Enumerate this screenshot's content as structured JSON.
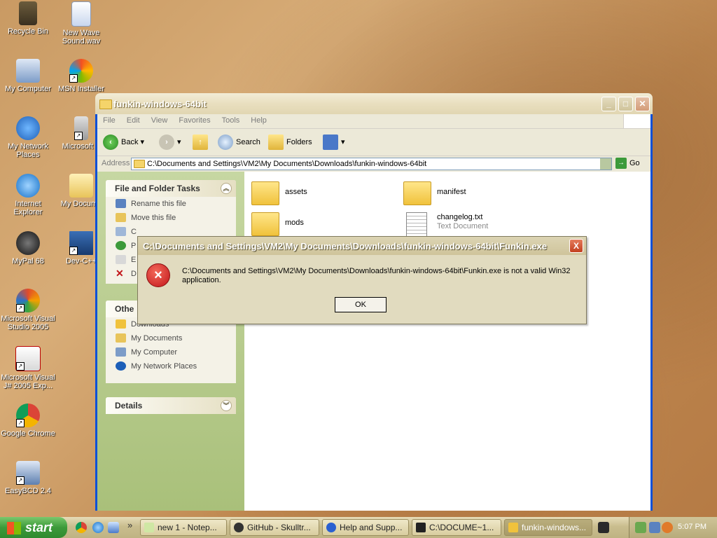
{
  "desktop_icons": [
    {
      "label": "Recycle Bin",
      "icon": "recycle-bin-icon"
    },
    {
      "label": "New Wave Sound.wav",
      "icon": "media-file-icon"
    },
    {
      "label": "My Computer",
      "icon": "my-computer-icon"
    },
    {
      "label": "MSN Installer",
      "icon": "msn-icon"
    },
    {
      "label": "My Network Places",
      "icon": "network-places-icon"
    },
    {
      "label": "Microsoft P",
      "icon": "shortcut-icon"
    },
    {
      "label": "Internet Explorer",
      "icon": "internet-explorer-icon"
    },
    {
      "label": "My Docume",
      "icon": "my-documents-icon"
    },
    {
      "label": "MyPal 68",
      "icon": "mypal-icon"
    },
    {
      "label": "Dev-C++",
      "icon": "devcpp-icon"
    },
    {
      "label": "Microsoft Visual Studio 2005",
      "icon": "visual-studio-icon"
    },
    {
      "label": "Microsoft Visual J# 2005 Exp...",
      "icon": "visual-j-icon"
    },
    {
      "label": "Google Chrome",
      "icon": "chrome-icon"
    },
    {
      "label": "EasyBCD 2.4",
      "icon": "easybcd-icon"
    }
  ],
  "explorer": {
    "title": "funkin-windows-64bit",
    "menu": [
      "File",
      "Edit",
      "View",
      "Favorites",
      "Tools",
      "Help"
    ],
    "toolbar": {
      "back": "Back",
      "search": "Search",
      "folders": "Folders"
    },
    "address_label": "Address",
    "address": "C:\\Documents and Settings\\VM2\\My Documents\\Downloads\\funkin-windows-64bit",
    "go": "Go",
    "tasks_panel": {
      "title": "File and Folder Tasks",
      "items": [
        "Rename this file",
        "Move this file",
        "C",
        "P",
        "E",
        "D"
      ]
    },
    "other_panel": {
      "title": "Othe",
      "items": [
        "Downloads",
        "My Documents",
        "My Computer",
        "My Network Places"
      ]
    },
    "details_panel": {
      "title": "Details"
    },
    "files": [
      {
        "name": "assets",
        "subtitle": ""
      },
      {
        "name": "manifest",
        "subtitle": ""
      },
      {
        "name": "mods",
        "subtitle": ""
      },
      {
        "name": "changelog.txt",
        "subtitle": "Text Document"
      }
    ]
  },
  "dialog": {
    "title": "C:\\Documents and Settings\\VM2\\My Documents\\Downloads\\funkin-windows-64bit\\Funkin.exe",
    "message": "C:\\Documents and Settings\\VM2\\My Documents\\Downloads\\funkin-windows-64bit\\Funkin.exe is not a valid Win32 application.",
    "ok": "OK",
    "close": "X",
    "error_glyph": "×"
  },
  "taskbar": {
    "start": "start",
    "tasks": [
      "new 1 - Notep...",
      "GitHub - Skulltr...",
      "Help and Supp...",
      "C:\\DOCUME~1...",
      "funkin-windows..."
    ],
    "clock": "5:07 PM",
    "overflow": "»"
  },
  "colors": {
    "xp_green": "#3c9a3a",
    "error_red": "#c2151a",
    "folder_yellow": "#f0c23c"
  }
}
